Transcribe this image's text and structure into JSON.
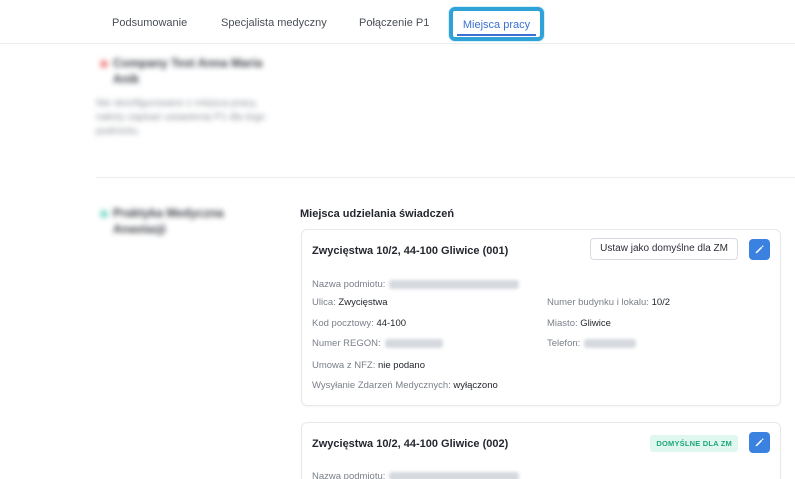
{
  "tabs": [
    {
      "label": "Podsumowanie"
    },
    {
      "label": "Specjalista medyczny"
    },
    {
      "label": "Połączenie P1"
    },
    {
      "label": "Miejsca pracy",
      "active": true
    }
  ],
  "left": {
    "company_title": "Company Test Anna Maria Anik",
    "company_text": "Nie skonfigurowano z miejsca pracy, należy zapisać ustawienia P1 dla tego podmiotu.",
    "practice_title": "Praktyka Medyczna Anastazji"
  },
  "section_title": "Miejsca udzielania świadczeń",
  "cards": [
    {
      "title": "Zwycięstwa 10/2, 44-100 Gliwice (001)",
      "set_default_label": "Ustaw jako domyślne dla ZM",
      "fields": {
        "podmiot_label": "Nazwa podmiotu:",
        "ulica_label": "Ulica:",
        "ulica_value": "Zwycięstwa",
        "numer_label": "Numer budynku i lokalu:",
        "numer_value": "10/2",
        "kod_label": "Kod pocztowy:",
        "kod_value": "44-100",
        "miasto_label": "Miasto:",
        "miasto_value": "Gliwice",
        "regon_label": "Numer REGON:",
        "telefon_label": "Telefon:",
        "nfz_label": "Umowa z NFZ:",
        "nfz_value": "nie podano",
        "zdarzenia_label": "Wysyłanie Zdarzeń Medycznych:",
        "zdarzenia_value": "wyłączono"
      }
    },
    {
      "title": "Zwycięstwa 10/2, 44-100 Gliwice (002)",
      "badge": "DOMYŚLNE DLA ZM",
      "fields": {
        "podmiot_label": "Nazwa podmiotu:"
      }
    }
  ],
  "colors": {
    "accent": "#3b82e0",
    "tab_highlight": "#2fa3d8",
    "badge_bg": "#dff7ee",
    "badge_text": "#20a77a"
  },
  "icons": {
    "edit": "pencil-icon"
  }
}
